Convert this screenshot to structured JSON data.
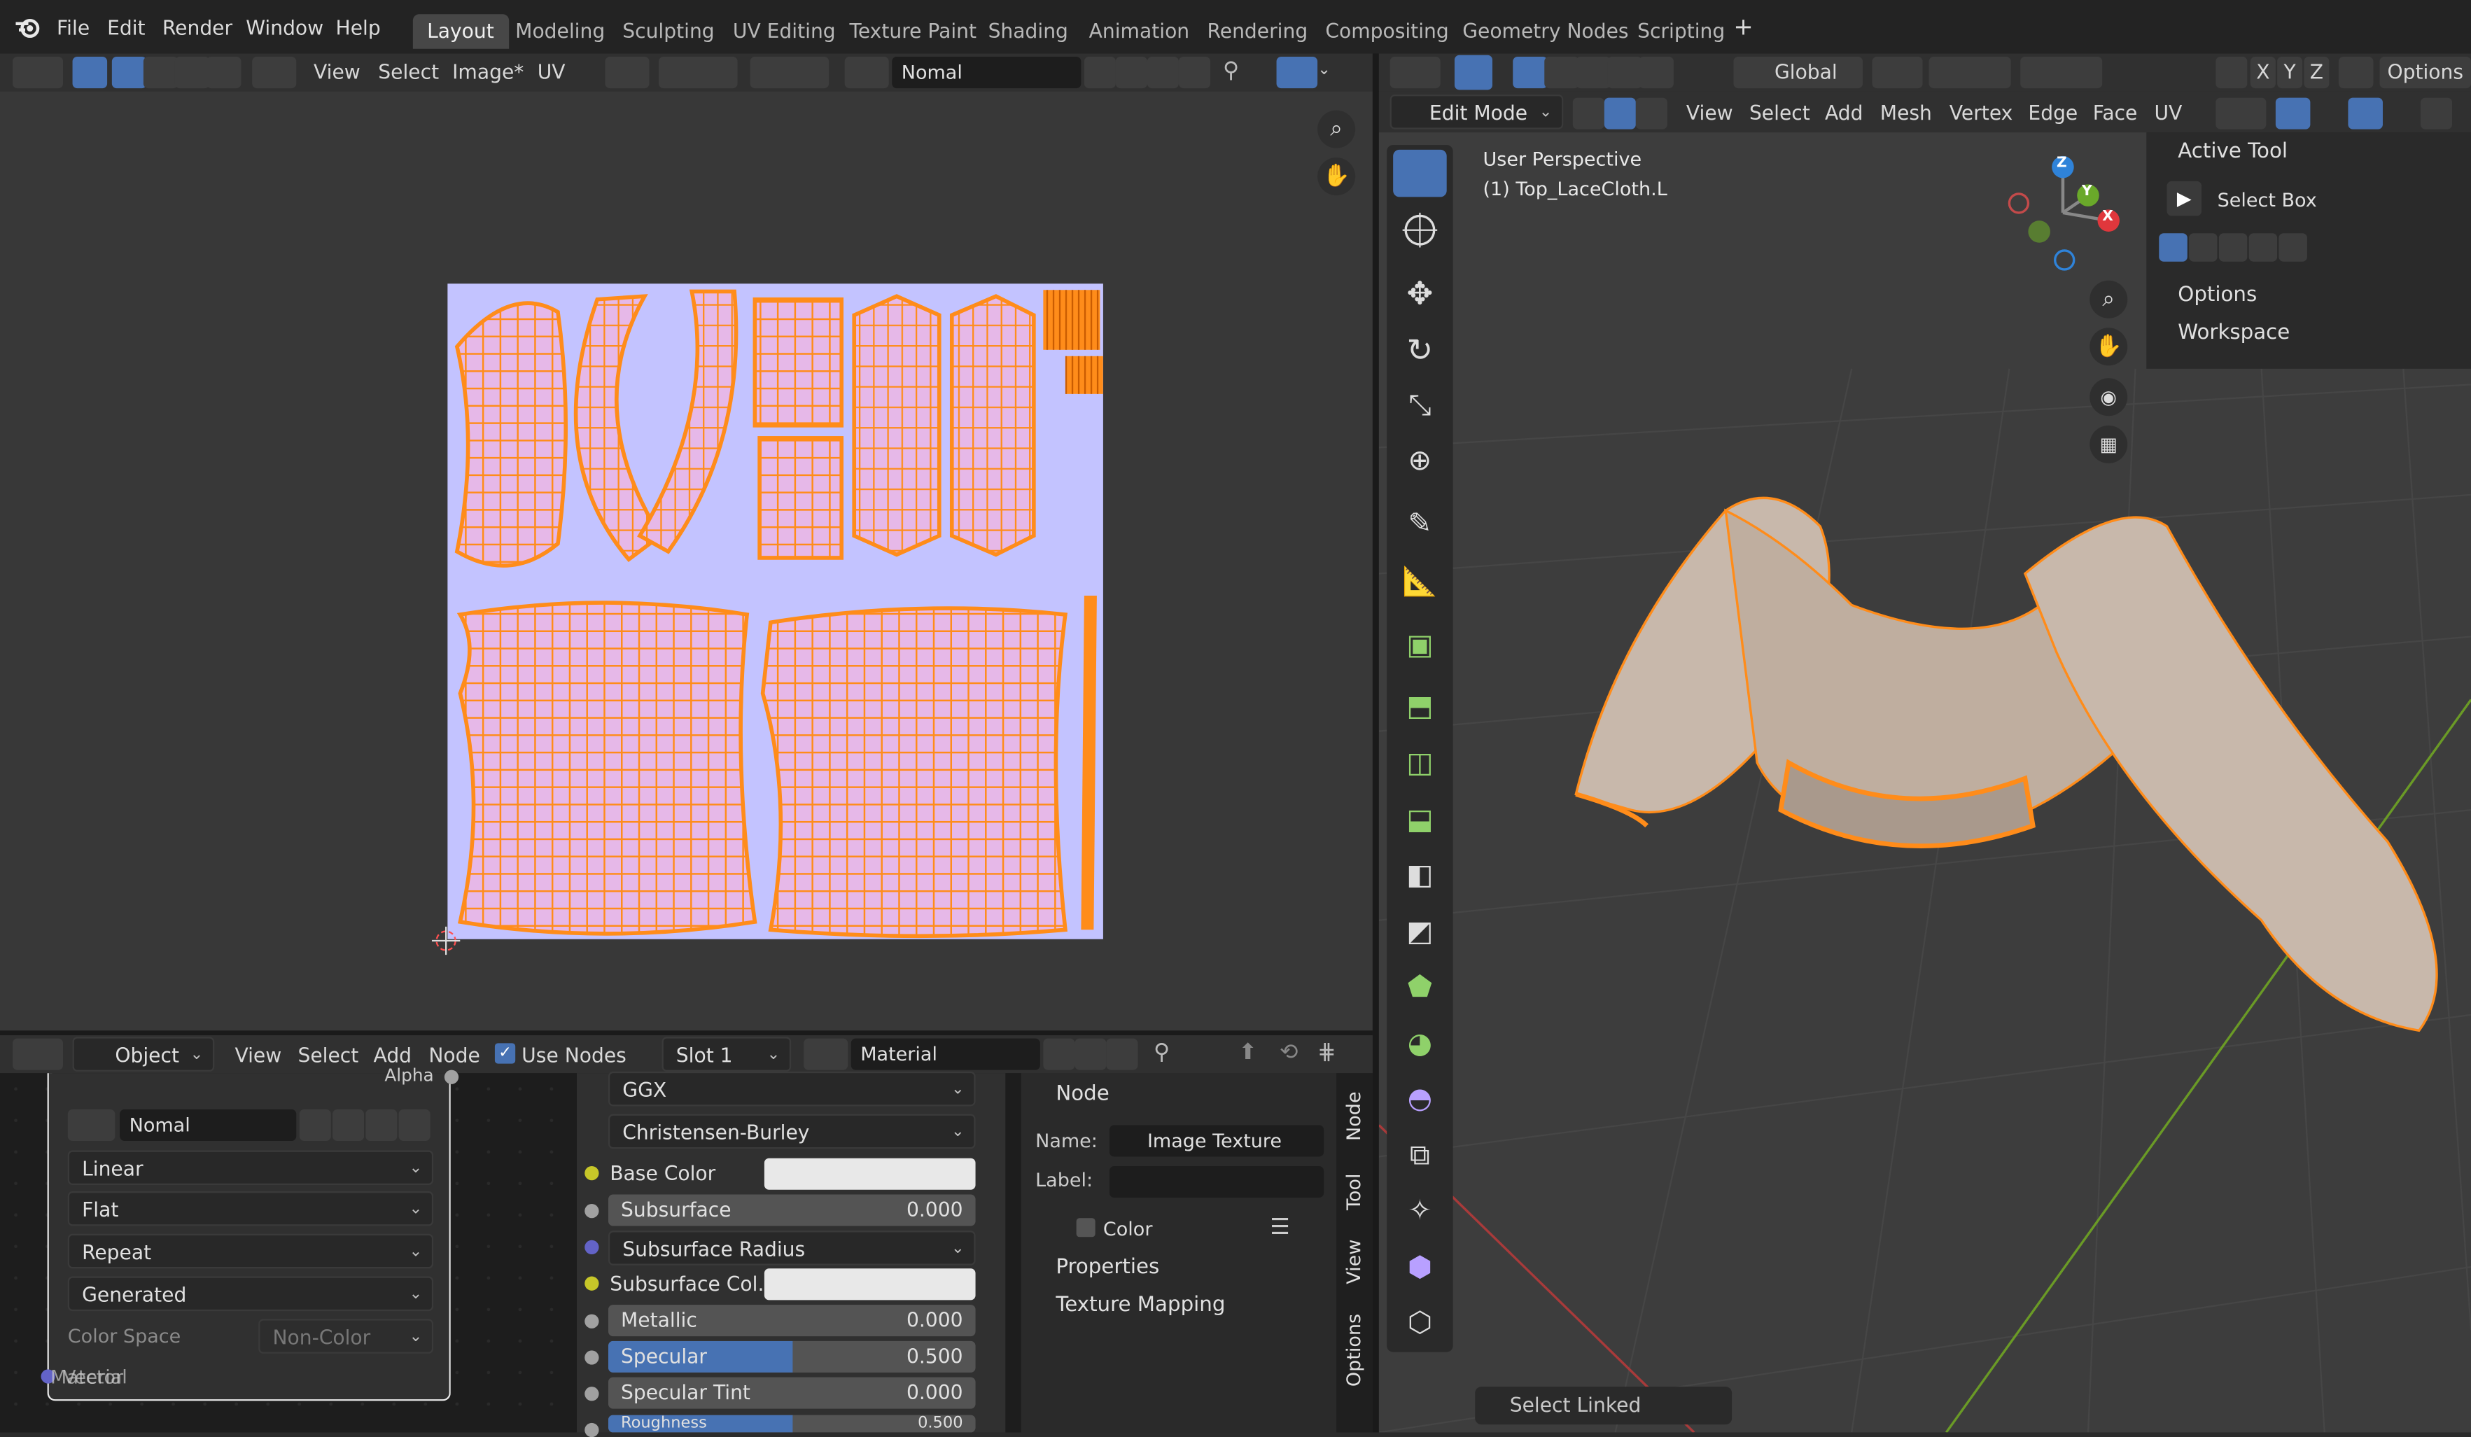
{
  "colors": {
    "accent": "#4772b3",
    "uv_background": "#c3c3ff",
    "uv_wire": "#ff8c1a",
    "mesh_surface": "#c8b8ab",
    "socket_yellow": "#c7c729",
    "socket_grey": "#a1a1a1",
    "socket_purple": "#6363c7"
  },
  "menu": [
    "File",
    "Edit",
    "Render",
    "Window",
    "Help"
  ],
  "workspaces": [
    "Layout",
    "Modeling",
    "Sculpting",
    "UV Editing",
    "Texture Paint",
    "Shading",
    "Animation",
    "Rendering",
    "Compositing",
    "Geometry Nodes",
    "Scripting"
  ],
  "add_workspace": "+",
  "image_editor": {
    "menus": [
      "View",
      "Select",
      "Image*",
      "UV"
    ],
    "image_name": "Nomal"
  },
  "viewport": {
    "transform": "Global",
    "axes": [
      "X",
      "Y",
      "Z"
    ],
    "options_label": "Options",
    "mode": "Edit Mode",
    "menus": [
      "View",
      "Select",
      "Add",
      "Mesh",
      "Vertex",
      "Edge",
      "Face",
      "UV"
    ],
    "overlay_title": "User Perspective",
    "overlay_object": "(1) Top_LaceCloth.L",
    "gizmo_z": "Z",
    "gizmo_y": "Y",
    "gizmo_x": "X",
    "last_operator": "Select Linked"
  },
  "tool_panel": {
    "active_tool_header": "Active Tool",
    "tool_name": "Select Box",
    "options": "Options",
    "workspace": "Workspace"
  },
  "node_editor": {
    "object_type": "Object",
    "menus": [
      "View",
      "Select",
      "Add",
      "Node"
    ],
    "use_nodes": "Use Nodes",
    "slot": "Slot 1",
    "material": "Material",
    "image_node": {
      "alpha_label": "Alpha",
      "image_name": "Nomal",
      "interpolation": "Linear",
      "projection": "Flat",
      "extension": "Repeat",
      "source": "Generated",
      "color_space_label": "Color Space",
      "color_space": "Non-Color",
      "vector_label": "Vector",
      "material_label": "Material"
    },
    "bsdf": {
      "distribution": "GGX",
      "subsurface_method": "Christensen-Burley",
      "base_color": "Base Color",
      "subsurface": "Subsurface",
      "subsurface_value": "0.000",
      "subsurface_radius": "Subsurface Radius",
      "subsurface_color": "Subsurface Col...",
      "metallic": "Metallic",
      "metallic_value": "0.000",
      "specular": "Specular",
      "specular_value": "0.500",
      "specular_fill": 0.5,
      "specular_tint": "Specular Tint",
      "specular_tint_value": "0.000",
      "roughness": "Roughness",
      "roughness_value": "0.500"
    },
    "sidebar": {
      "header": "Node",
      "name_label": "Name:",
      "name_value": "Image Texture",
      "label_label": "Label:",
      "label_value": "",
      "color_section": "Color",
      "properties": "Properties",
      "texture_mapping": "Texture Mapping",
      "tabs": [
        "Node",
        "Tool",
        "View",
        "Options"
      ]
    }
  }
}
